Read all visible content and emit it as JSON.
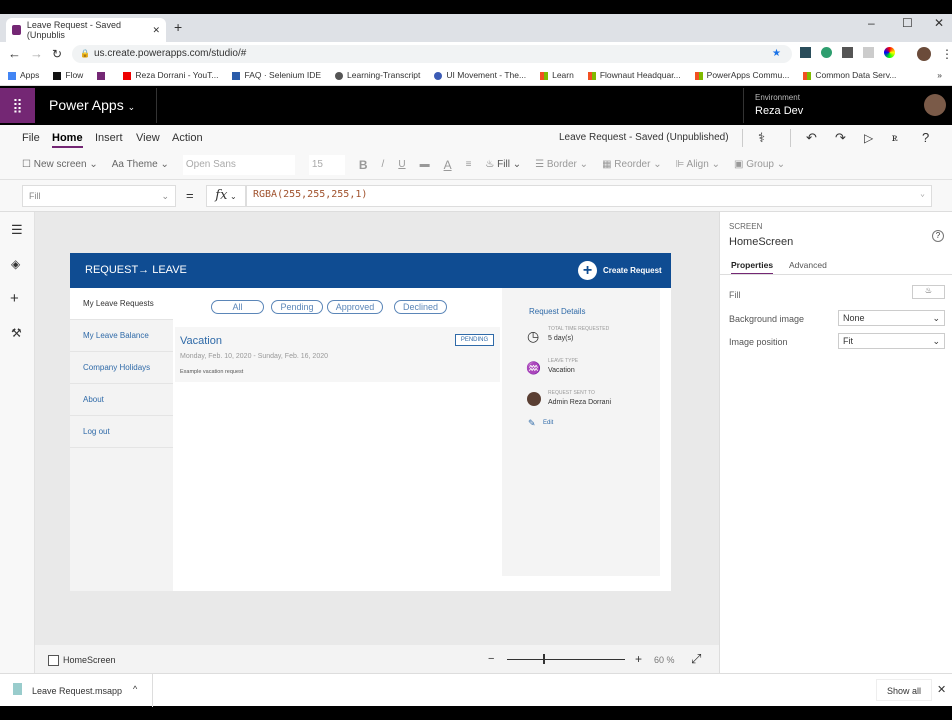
{
  "browser": {
    "tab_title": "Leave Request - Saved (Unpublis",
    "url": "us.create.powerapps.com/studio/#",
    "bookmarks": [
      "Apps",
      "Flow",
      "Reza Dorrani - YouT...",
      "FAQ · Selenium IDE",
      "Learning-Transcript",
      "UI Movement - The...",
      "Learn",
      "Flownaut Headquar...",
      "PowerApps Commu...",
      "Common Data Serv..."
    ]
  },
  "header": {
    "app_name": "Power Apps",
    "env_label": "Environment",
    "env_name": "Reza Dev"
  },
  "menu": {
    "items": [
      "File",
      "Home",
      "Insert",
      "View",
      "Action"
    ],
    "active": "Home",
    "doc_status": "Leave Request - Saved (Unpublished)"
  },
  "ribbon": {
    "new_screen": "New screen",
    "theme": "Theme",
    "font": "Open Sans",
    "font_size": "15",
    "bold": "B",
    "italic": "/",
    "underline": "U",
    "font_color": "A",
    "fill": "Fill",
    "border": "Border",
    "reorder": "Reorder",
    "align": "Align",
    "group": "Group"
  },
  "formula": {
    "property": "Fill",
    "fx": "fx",
    "value": "RGBA(255,255,255,1)"
  },
  "app": {
    "title": "REQUEST→ LEAVE",
    "create": "Create Request",
    "nav": [
      "My Leave Requests",
      "My Leave Balance",
      "Company Holidays",
      "About",
      "Log out"
    ],
    "filters": [
      "All",
      "Pending",
      "Approved",
      "Declined"
    ],
    "item": {
      "title": "Vacation",
      "status": "PENDING",
      "dates": "Monday, Feb. 10, 2020 - Sunday, Feb. 16, 2020",
      "desc": "Example vacation request"
    },
    "details": {
      "heading": "Request Details",
      "time_label": "TOTAL TIME REQUESTED",
      "time": "5 day(s)",
      "type_label": "LEAVE TYPE",
      "type": "Vacation",
      "sent_label": "REQUEST SENT TO",
      "sent": "Admin Reza Dorrani",
      "edit": "Edit"
    }
  },
  "status": {
    "screen": "HomeScreen",
    "zoom": "60",
    "zoom_unit": "%",
    "zoom_minus": "−",
    "zoom_plus": "+"
  },
  "panel": {
    "kind": "SCREEN",
    "name": "HomeScreen",
    "tabs": [
      "Properties",
      "Advanced"
    ],
    "fill_label": "Fill",
    "bg_label": "Background image",
    "bg_value": "None",
    "pos_label": "Image position",
    "pos_value": "Fit"
  },
  "download": {
    "file": "Leave Request.msapp",
    "show_all": "Show all"
  },
  "colors": {
    "brand": "#742774",
    "app_header": "#0f4c92",
    "link": "#2f6aa8"
  }
}
